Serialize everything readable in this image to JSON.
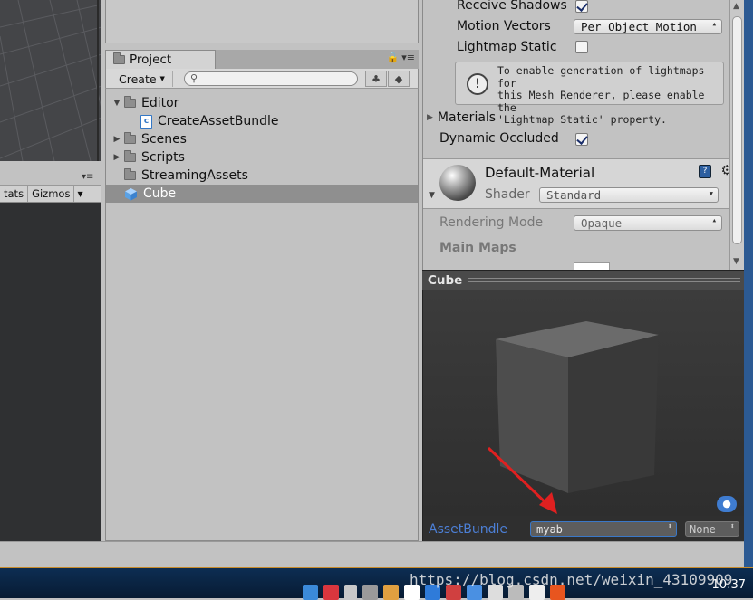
{
  "scene": {
    "toolbar": {
      "stats_label": "tats",
      "gizmos_label": "Gizmos",
      "menu_glyph": "▾≡"
    }
  },
  "project": {
    "tab_label": "Project",
    "tab_controls": "🔒 ▾≡",
    "create_label": "Create",
    "search_placeholder": "",
    "tree": [
      {
        "label": "Editor",
        "type": "folder",
        "expanded": true,
        "depth": 0
      },
      {
        "label": "CreateAssetBundle",
        "type": "script",
        "depth": 1
      },
      {
        "label": "Scenes",
        "type": "folder",
        "expanded": false,
        "depth": 0
      },
      {
        "label": "Scripts",
        "type": "folder",
        "expanded": false,
        "depth": 0
      },
      {
        "label": "StreamingAssets",
        "type": "folder",
        "expanded": false,
        "depth": 0
      },
      {
        "label": "Cube",
        "type": "prefab",
        "depth": 0,
        "selected": true
      }
    ]
  },
  "inspector": {
    "receive_shadows": {
      "label": "Receive Shadows",
      "checked": true
    },
    "motion_vectors": {
      "label": "Motion Vectors",
      "value": "Per Object Motion"
    },
    "lightmap_static": {
      "label": "Lightmap Static",
      "checked": false
    },
    "help_text_1": "To enable generation of lightmaps for",
    "help_text_2": "this Mesh Renderer, please enable the",
    "help_text_3": "'Lightmap Static' property.",
    "materials_label": "Materials",
    "dynamic_occluded": {
      "label": "Dynamic Occluded",
      "checked": true
    },
    "material": {
      "name": "Default-Material",
      "shader_label": "Shader",
      "shader_value": "Standard",
      "rendering_mode_label": "Rendering Mode",
      "rendering_mode_value": "Opaque",
      "main_maps_label": "Main Maps"
    }
  },
  "preview": {
    "title": "Cube",
    "assetbundle_label": "AssetBundle",
    "assetbundle_value": "myab",
    "variant_value": "None"
  },
  "taskbar": {
    "clock": "10:37",
    "watermark": "https://blog.csdn.net/weixin_43109909"
  },
  "colors": {
    "selection": "#8f8f8f",
    "assetbundle_blue": "#4c7fd6",
    "arrow_red": "#e02020",
    "taskbar": "#0d2d52"
  }
}
